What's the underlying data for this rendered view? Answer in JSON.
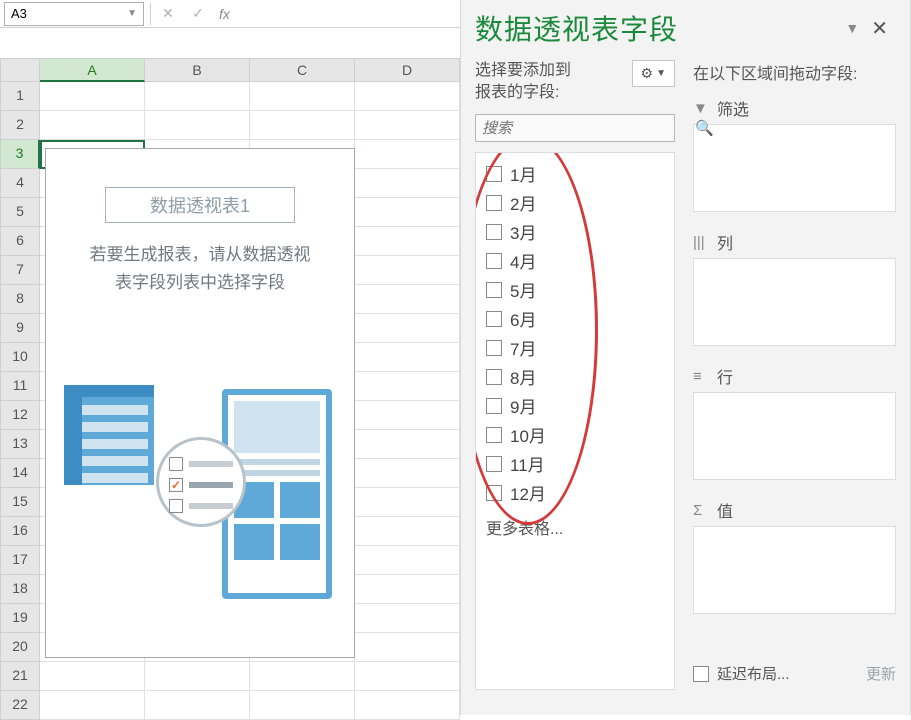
{
  "name_box": "A3",
  "formula_value": "",
  "fx_label": "fx",
  "columns": [
    "A",
    "B",
    "C",
    "D"
  ],
  "active_col": 0,
  "rows": [
    "1",
    "2",
    "3",
    "4",
    "5",
    "6",
    "7",
    "8",
    "9",
    "10",
    "11",
    "12",
    "13",
    "14",
    "15",
    "16",
    "17",
    "18",
    "19",
    "20",
    "21",
    "22"
  ],
  "active_row": 2,
  "pivot_placeholder": {
    "title": "数据透视表1",
    "text_l1": "若要生成报表，请从数据透视",
    "text_l2": "表字段列表中选择字段"
  },
  "pane": {
    "title": "数据透视表字段",
    "left_label_l1": "选择要添加到",
    "left_label_l2": "报表的字段:",
    "search_placeholder": "搜索",
    "fields": [
      "1月",
      "2月",
      "3月",
      "4月",
      "5月",
      "6月",
      "7月",
      "8月",
      "9月",
      "10月",
      "11月",
      "12月"
    ],
    "more_tables": "更多表格...",
    "right_label": "在以下区域间拖动字段:",
    "zones": {
      "filter": "筛选",
      "columns": "列",
      "rows": "行",
      "values": "值"
    },
    "defer_label": "延迟布局...",
    "update_label": "更新"
  }
}
